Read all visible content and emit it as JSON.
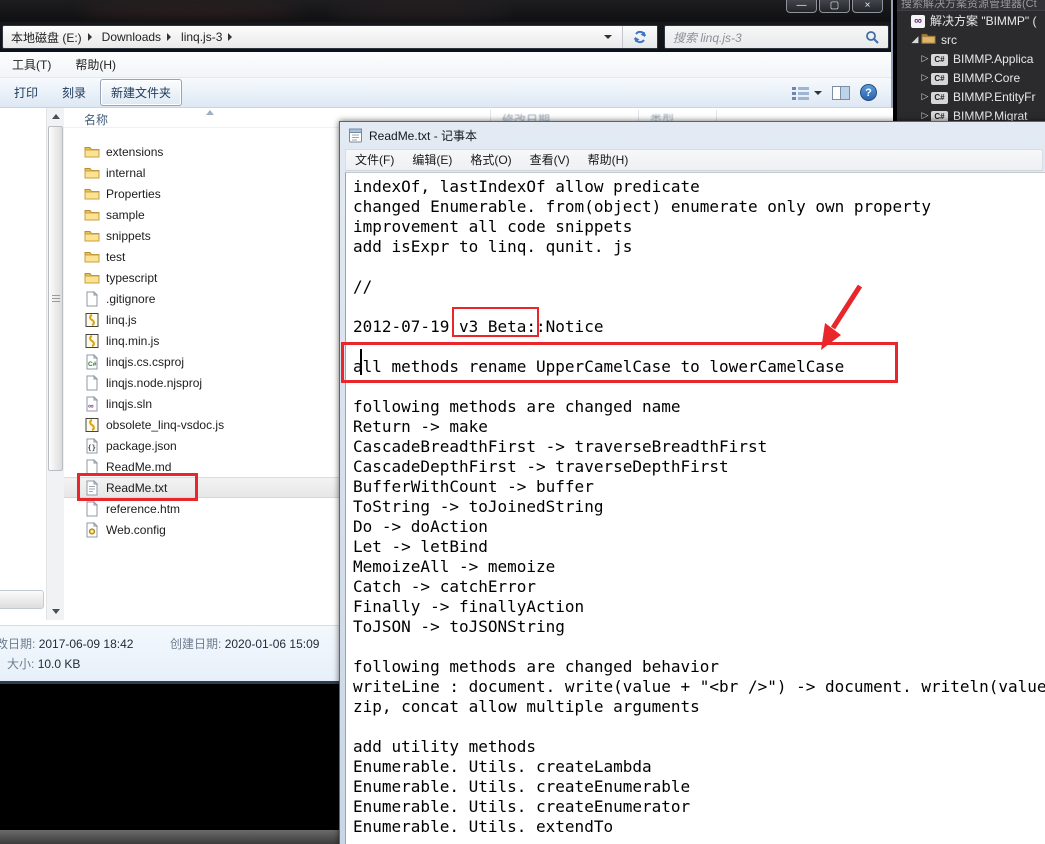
{
  "explorer": {
    "breadcrumb": {
      "segments": [
        "本地磁盘 (E:)",
        "Downloads",
        "linq.js-3"
      ]
    },
    "search": {
      "placeholder": "搜索 linq.js-3"
    },
    "menu": [
      "工具(T)",
      "帮助(H)"
    ],
    "toolbar": {
      "print": "打印",
      "burn": "刻录",
      "new_folder": "新建文件夹"
    },
    "columns": [
      "名称",
      "修改日期",
      "类型"
    ],
    "files": [
      {
        "name": "extensions",
        "icon": "folder"
      },
      {
        "name": "internal",
        "icon": "folder"
      },
      {
        "name": "Properties",
        "icon": "folder"
      },
      {
        "name": "sample",
        "icon": "folder"
      },
      {
        "name": "snippets",
        "icon": "folder"
      },
      {
        "name": "test",
        "icon": "folder"
      },
      {
        "name": "typescript",
        "icon": "folder"
      },
      {
        "name": ".gitignore",
        "icon": "page"
      },
      {
        "name": "linq.js",
        "icon": "js"
      },
      {
        "name": "linq.min.js",
        "icon": "js"
      },
      {
        "name": "linqjs.cs.csproj",
        "icon": "csharp"
      },
      {
        "name": "linqjs.node.njsproj",
        "icon": "page"
      },
      {
        "name": "linqjs.sln",
        "icon": "sln"
      },
      {
        "name": "obsolete_linq-vsdoc.js",
        "icon": "js"
      },
      {
        "name": "package.json",
        "icon": "json"
      },
      {
        "name": "ReadMe.md",
        "icon": "page"
      },
      {
        "name": "ReadMe.txt",
        "icon": "textpage",
        "selected": true
      },
      {
        "name": "reference.htm",
        "icon": "page"
      },
      {
        "name": "Web.config",
        "icon": "config"
      }
    ],
    "details": {
      "modified_label": "修改日期:",
      "modified_value": "2017-06-09 18:42",
      "created_label": "创建日期:",
      "created_value": "2020-01-06 15:09",
      "size_label": "大小:",
      "size_value": "10.0 KB"
    }
  },
  "notepad": {
    "title": "ReadMe.txt - 记事本",
    "menu": [
      "文件(F)",
      "编辑(E)",
      "格式(O)",
      "查看(V)",
      "帮助(H)"
    ],
    "lines": [
      "indexOf, lastIndexOf allow predicate",
      "changed Enumerable. from(object) enumerate only own property",
      "improvement all code snippets",
      "add isExpr to linq. qunit. js",
      "",
      "//",
      "",
      "2012-07-19 v3 Beta::Notice",
      "",
      "all methods rename UpperCamelCase to lowerCamelCase",
      "",
      "following methods are changed name",
      "Return -> make",
      "CascadeBreadthFirst -> traverseBreadthFirst",
      "CascadeDepthFirst -> traverseDepthFirst",
      "BufferWithCount -> buffer",
      "ToString -> toJoinedString",
      "Do -> doAction",
      "Let -> letBind",
      "MemoizeAll -> memoize",
      "Catch -> catchError",
      "Finally -> finallyAction",
      "ToJSON -> toJSONString",
      "",
      "following methods are changed behavior",
      "writeLine : document. write(value + \"<br />\") -> document. writeln(value",
      "zip, concat allow multiple arguments",
      "",
      "add utility methods",
      "Enumerable. Utils. createLambda",
      "Enumerable. Utils. createEnumerable",
      "Enumerable. Utils. createEnumerator",
      "Enumerable. Utils. extendTo"
    ]
  },
  "solution_explorer": {
    "search_hint": "搜索解决方案资源管理器(Ct",
    "rows": [
      {
        "label": "解决方案 \"BIMMP\" (",
        "icon": "vs-logo",
        "arrow": "none",
        "indent": 0
      },
      {
        "label": "src",
        "icon": "folder-dark",
        "arrow": "expanded",
        "indent": 1
      },
      {
        "label": "BIMMP.Applica",
        "icon": "csharp-project",
        "arrow": "collapsed",
        "indent": 2
      },
      {
        "label": "BIMMP.Core",
        "icon": "csharp-project",
        "arrow": "collapsed",
        "indent": 2
      },
      {
        "label": "BIMMP.EntityFr",
        "icon": "csharp-project",
        "arrow": "collapsed",
        "indent": 2
      },
      {
        "label": "BIMMP.Migrat",
        "icon": "csharp-project",
        "arrow": "collapsed",
        "indent": 2
      }
    ]
  },
  "annotations": {
    "highlight_color": "#e8262b"
  }
}
